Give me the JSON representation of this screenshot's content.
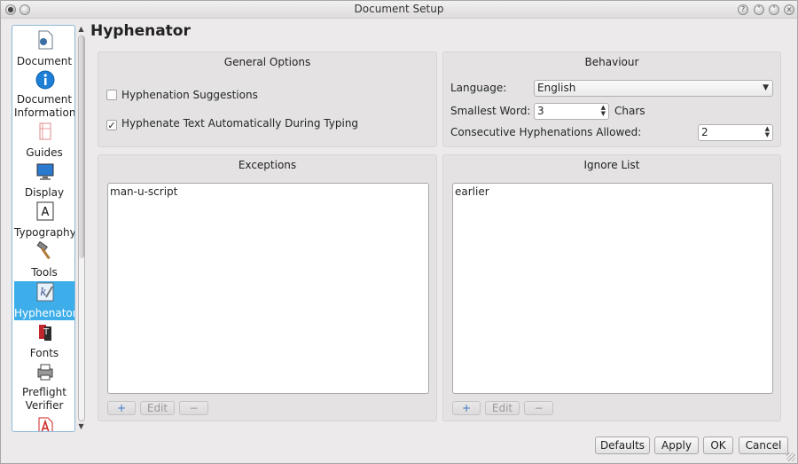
{
  "window": {
    "title": "Document Setup"
  },
  "sidebar": {
    "items": [
      {
        "label": "Document",
        "icon": "document-icon"
      },
      {
        "label": "Document Information",
        "icon": "info-icon"
      },
      {
        "label": "Guides",
        "icon": "guides-icon"
      },
      {
        "label": "Display",
        "icon": "display-icon"
      },
      {
        "label": "Typography",
        "icon": "typography-icon"
      },
      {
        "label": "Tools",
        "icon": "hammer-icon"
      },
      {
        "label": "Hyphenator",
        "icon": "hyphenator-icon",
        "selected": true
      },
      {
        "label": "Fonts",
        "icon": "fonts-icon"
      },
      {
        "label": "Preflight Verifier",
        "icon": "preflight-icon"
      }
    ]
  },
  "page": {
    "title": "Hyphenator"
  },
  "general": {
    "title": "General Options",
    "hyphenation_suggestions": {
      "label": "Hyphenation Suggestions",
      "checked": false
    },
    "hyphenate_auto": {
      "label": "Hyphenate Text Automatically During Typing",
      "checked": true
    }
  },
  "behaviour": {
    "title": "Behaviour",
    "language_label": "Language:",
    "language_value": "English",
    "smallest_word_label": "Smallest Word:",
    "smallest_word_value": "3",
    "smallest_word_suffix": "Chars",
    "consecutive_label": "Consecutive Hyphenations Allowed:",
    "consecutive_value": "2"
  },
  "exceptions": {
    "title": "Exceptions",
    "items": [
      "man-u-script"
    ],
    "add_label": "+",
    "edit_label": "Edit",
    "remove_label": "−"
  },
  "ignore": {
    "title": "Ignore List",
    "items": [
      "earlier"
    ],
    "add_label": "+",
    "edit_label": "Edit",
    "remove_label": "−"
  },
  "buttons": {
    "defaults": "Defaults",
    "apply": "Apply",
    "ok": "OK",
    "cancel": "Cancel"
  }
}
